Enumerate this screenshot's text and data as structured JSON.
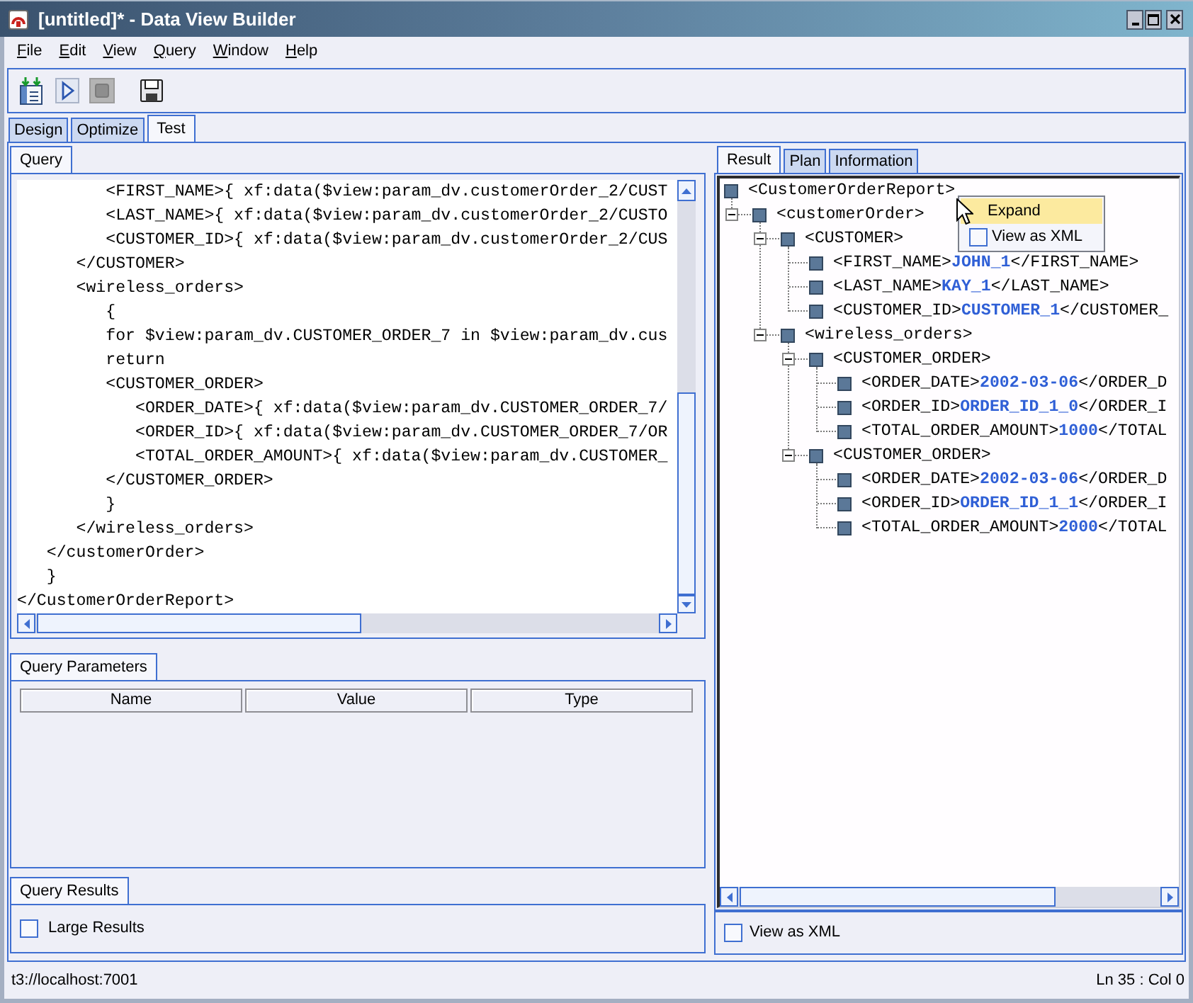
{
  "window": {
    "title": "[untitled]* - Data View Builder"
  },
  "menu_bar": [
    "File",
    "Edit",
    "View",
    "Query",
    "Window",
    "Help"
  ],
  "toolbar": [
    [
      {
        "kind": "import",
        "disabled": false
      },
      {
        "kind": "run",
        "disabled": false
      },
      {
        "kind": "stop",
        "disabled": true
      }
    ],
    [
      {
        "kind": "save",
        "disabled": false
      }
    ]
  ],
  "main_tabs": [
    {
      "label": "Design",
      "selected": false
    },
    {
      "label": "Optimize",
      "selected": false
    },
    {
      "label": "Test",
      "selected": true
    }
  ],
  "query_panel": {
    "tabs": [
      {
        "label": "Query",
        "selected": true
      }
    ],
    "code_lines": [
      "         <FIRST_NAME>{ xf:data($view:param_dv.customerOrder_2/CUST",
      "         <LAST_NAME>{ xf:data($view:param_dv.customerOrder_2/CUSTO",
      "         <CUSTOMER_ID>{ xf:data($view:param_dv.customerOrder_2/CUS",
      "      </CUSTOMER>",
      "      <wireless_orders>",
      "         {",
      "         for $view:param_dv.CUSTOMER_ORDER_7 in $view:param_dv.cus",
      "         return",
      "         <CUSTOMER_ORDER>",
      "            <ORDER_DATE>{ xf:data($view:param_dv.CUSTOMER_ORDER_7/",
      "            <ORDER_ID>{ xf:data($view:param_dv.CUSTOMER_ORDER_7/OR",
      "            <TOTAL_ORDER_AMOUNT>{ xf:data($view:param_dv.CUSTOMER_",
      "         </CUSTOMER_ORDER>",
      "         }",
      "      </wireless_orders>",
      "   </customerOrder>",
      "   }",
      "</CustomerOrderReport>"
    ]
  },
  "query_parameters": {
    "tabs": [
      {
        "label": "Query Parameters",
        "selected": true
      }
    ],
    "columns": [
      "Name",
      "Value",
      "Type"
    ]
  },
  "query_results": {
    "tabs": [
      {
        "label": "Query Results",
        "selected": true
      }
    ],
    "large_results": {
      "label": "Large Results",
      "checked": false
    }
  },
  "result_panel": {
    "tabs": [
      {
        "label": "Result",
        "selected": true
      },
      {
        "label": "Plan",
        "selected": false
      },
      {
        "label": "Information",
        "selected": false
      }
    ],
    "tree": {
      "root": {
        "tag": "<CustomerOrderReport>",
        "children": [
          {
            "tag": "<customerOrder>",
            "expanded": true,
            "children": [
              {
                "tag": "<CUSTOMER>",
                "expanded": true,
                "children": [
                  {
                    "open_tag": "<FIRST_NAME>",
                    "value": "JOHN_1",
                    "close_tag": "</FIRST_NAME>"
                  },
                  {
                    "open_tag": "<LAST_NAME>",
                    "value": "KAY_1",
                    "close_tag": "</LAST_NAME>"
                  },
                  {
                    "open_tag": "<CUSTOMER_ID>",
                    "value": "CUSTOMER_1",
                    "close_tag": "</CUSTOMER_"
                  }
                ]
              },
              {
                "tag": "<wireless_orders>",
                "expanded": true,
                "children": [
                  {
                    "tag": "<CUSTOMER_ORDER>",
                    "expanded": true,
                    "children": [
                      {
                        "open_tag": "<ORDER_DATE>",
                        "value": "2002-03-06",
                        "close_tag": "</ORDER_D"
                      },
                      {
                        "open_tag": "<ORDER_ID>",
                        "value": "ORDER_ID_1_0",
                        "close_tag": "</ORDER_I"
                      },
                      {
                        "open_tag": "<TOTAL_ORDER_AMOUNT>",
                        "value": "1000",
                        "close_tag": "</TOTAL"
                      }
                    ]
                  },
                  {
                    "tag": "<CUSTOMER_ORDER>",
                    "expanded": true,
                    "children": [
                      {
                        "open_tag": "<ORDER_DATE>",
                        "value": "2002-03-06",
                        "close_tag": "</ORDER_D"
                      },
                      {
                        "open_tag": "<ORDER_ID>",
                        "value": "ORDER_ID_1_1",
                        "close_tag": "</ORDER_I"
                      },
                      {
                        "open_tag": "<TOTAL_ORDER_AMOUNT>",
                        "value": "2000",
                        "close_tag": "</TOTAL"
                      }
                    ]
                  }
                ]
              }
            ]
          }
        ]
      }
    },
    "context_menu": {
      "items": [
        {
          "kind": "action",
          "label": "Expand",
          "selected": true
        },
        {
          "kind": "checkbox",
          "label": "View as XML",
          "checked": false,
          "selected": false
        }
      ]
    },
    "view_as_xml": {
      "label": "View as XML",
      "checked": false
    }
  },
  "status_bar": {
    "connection": "t3://localhost:7001",
    "cursor_position": "Ln 35 : Col 0"
  }
}
